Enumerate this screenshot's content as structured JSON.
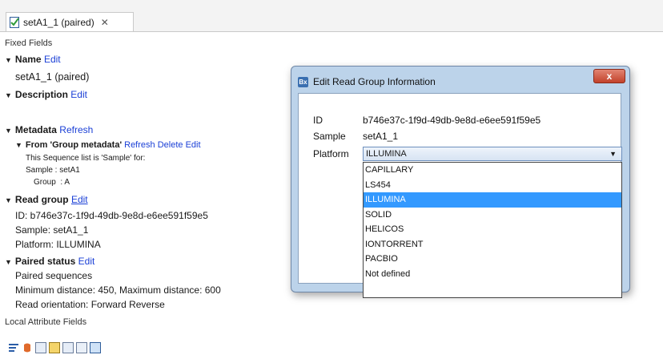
{
  "tab": {
    "title": "setA1_1 (paired)",
    "close_glyph": "✕"
  },
  "panel": {
    "fixed_fields": "Fixed Fields",
    "name": {
      "label": "Name",
      "action": "Edit",
      "value": "setA1_1 (paired)"
    },
    "description": {
      "label": "Description",
      "action": "Edit"
    },
    "metadata": {
      "label": "Metadata",
      "action": "Refresh",
      "from": {
        "label": "From 'Group metadata'",
        "actions": [
          "Refresh",
          "Delete",
          "Edit"
        ],
        "note": "This Sequence list is 'Sample' for:",
        "sample": "Sample : setA1",
        "group": "Group  : A"
      }
    },
    "read_group": {
      "label": "Read group",
      "action": "Edit",
      "lines": [
        "ID: b746e37c-1f9d-49db-9e8d-e6ee591f59e5",
        "Sample: setA1_1",
        "Platform: ILLUMINA"
      ]
    },
    "paired_status": {
      "label": "Paired status",
      "action": "Edit",
      "lines": [
        "Paired sequences",
        "Minimum distance: 450, Maximum distance: 600",
        "Read orientation: Forward Reverse"
      ]
    },
    "local_attribute_fields": "Local Attribute Fields"
  },
  "dialog": {
    "icon_text": "Bx",
    "title": "Edit Read Group Information",
    "close_label": "x",
    "fields": {
      "id_label": "ID",
      "id_value": "b746e37c-1f9d-49db-9e8d-e6ee591f59e5",
      "sample_label": "Sample",
      "sample_value": "setA1_1",
      "platform_label": "Platform"
    },
    "platform_selected": "ILLUMINA",
    "platform_options": [
      "CAPILLARY",
      "LS454",
      "ILLUMINA",
      "SOLID",
      "HELICOS",
      "IONTORRENT",
      "PACBIO",
      "Not defined"
    ]
  },
  "colors": {
    "link": "#1a3fd6",
    "selection": "#3399ff",
    "dialog_frame": "#bcd3ea",
    "close_button": "#c2422b"
  },
  "toolbar_icons": [
    "list-icon",
    "text-icon",
    "table-icon",
    "arrow-icon",
    "grid-icon",
    "circle-icon",
    "document-icon"
  ]
}
